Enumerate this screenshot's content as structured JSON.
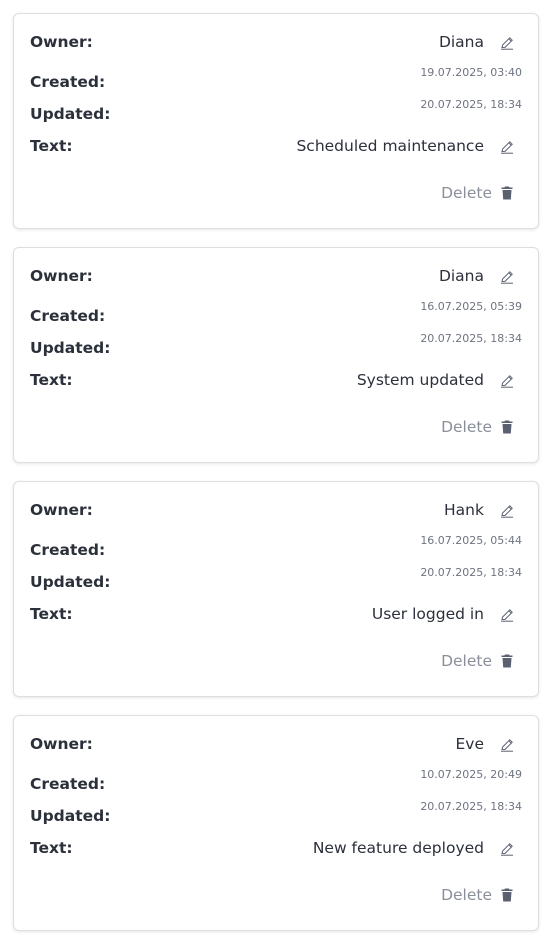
{
  "labels": {
    "owner": "Owner:",
    "created": "Created:",
    "updated": "Updated:",
    "text": "Text:",
    "delete": "Delete"
  },
  "colors": {
    "text": "#2b303b",
    "muted": "#6e7480",
    "delete": "#8a8f99",
    "border": "#dcdfe4"
  },
  "icons": {
    "edit": "pencil-icon",
    "delete": "trash-icon"
  },
  "entries": [
    {
      "owner": "Diana",
      "created": "19.07.2025, 03:40",
      "updated": "20.07.2025, 18:34",
      "text": "Scheduled maintenance"
    },
    {
      "owner": "Diana",
      "created": "16.07.2025, 05:39",
      "updated": "20.07.2025, 18:34",
      "text": "System updated"
    },
    {
      "owner": "Hank",
      "created": "16.07.2025, 05:44",
      "updated": "20.07.2025, 18:34",
      "text": "User logged in"
    },
    {
      "owner": "Eve",
      "created": "10.07.2025, 20:49",
      "updated": "20.07.2025, 18:34",
      "text": "New feature deployed"
    }
  ]
}
